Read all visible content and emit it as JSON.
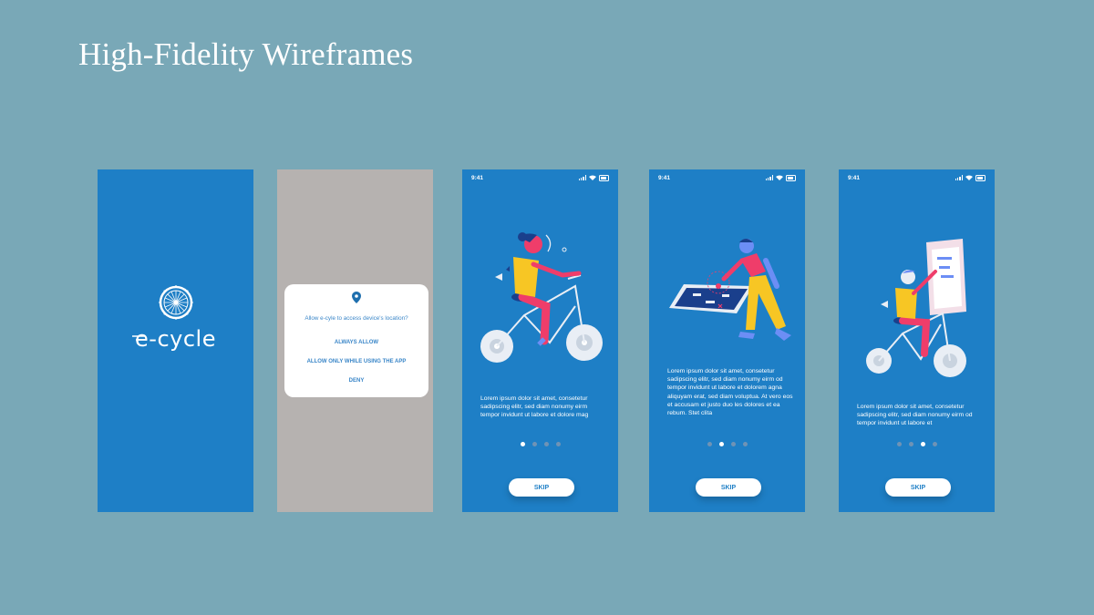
{
  "page_title": "High-Fidelity Wireframes",
  "colors": {
    "background": "#79a8b7",
    "screen_blue": "#1e7fc6",
    "dialog_overlay": "#b6b2b0",
    "accent": "#3a86c8"
  },
  "splash": {
    "logo_text": "e-cycle",
    "logo_icon": "bicycle-wheel-icon"
  },
  "permission": {
    "icon": "location-pin-icon",
    "question": "Allow e-cyle to access device's location?",
    "options": [
      "ALWAYS ALLOW",
      "ALLOW ONLY WHILE USING THE APP",
      "DENY"
    ]
  },
  "onboarding": [
    {
      "time": "9:41",
      "text": "Lorem ipsum dolor sit amet, consetetur sadipscing elitr, sed diam nonumy eirm tempor invidunt ut labore et dolore mag",
      "active_dot": 0,
      "skip_label": "SKIP"
    },
    {
      "time": "9:41",
      "text": "Lorem ipsum dolor sit amet, consetetur sadipscing elitr, sed diam nonumy eirm od tempor invidunt ut labore et dolorem agna aliquyam erat, sed diam voluptua. At vero eos et accusam et justo duo les dolores et ea rebum. Stet clita",
      "active_dot": 1,
      "skip_label": "SKIP"
    },
    {
      "time": "9:41",
      "text": "Lorem ipsum dolor sit amet, consetetur sadipscing elitr, sed diam nonumy eirm od tempor invidunt ut labore et",
      "active_dot": 2,
      "skip_label": "SKIP"
    }
  ]
}
